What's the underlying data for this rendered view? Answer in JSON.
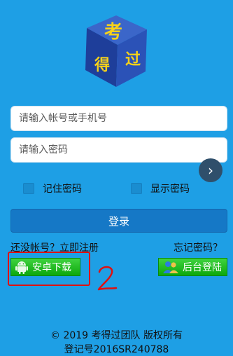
{
  "logo": {
    "char1": "考",
    "char2": "过",
    "char3": "得"
  },
  "form": {
    "account_placeholder": "请输入帐号或手机号",
    "password_placeholder": "请输入密码",
    "remember_label": "记住密码",
    "show_password_label": "显示密码",
    "login_label": "登录"
  },
  "links": {
    "register": "还没帐号？立即注册",
    "forgot": "忘记密码？"
  },
  "downloads": {
    "android_label": "安卓下载",
    "admin_label": "后台登陆"
  },
  "annotation": {
    "text": "2"
  },
  "footer": {
    "copyright": "© 2019 考得过团队 版权所有",
    "registration": "登记号2016SR240788"
  }
}
